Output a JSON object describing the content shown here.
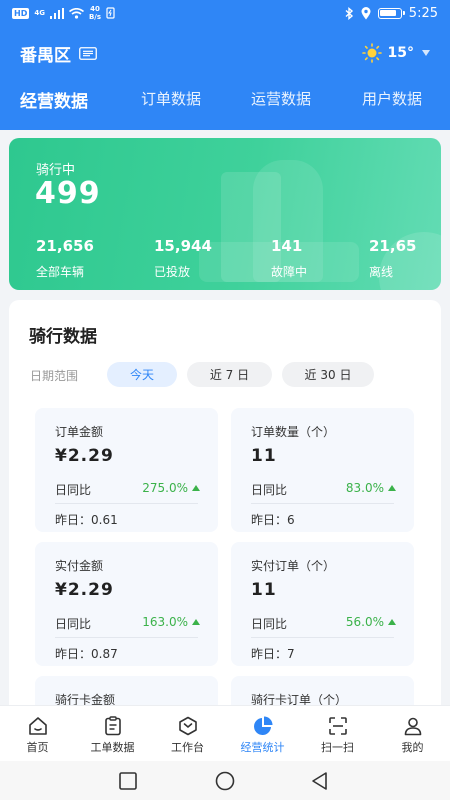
{
  "status_bar": {
    "hd_badge": "HD",
    "network": "4G",
    "speed_value": "40",
    "speed_unit": "B/s",
    "time": "5:25",
    "battery_percent": 85
  },
  "topbar": {
    "district": "番禺区",
    "temperature": "15°"
  },
  "tabs": [
    {
      "label": "经营数据",
      "active": true
    },
    {
      "label": "订单数据",
      "active": false
    },
    {
      "label": "运营数据",
      "active": false
    },
    {
      "label": "用户数据",
      "active": false
    }
  ],
  "ride_card": {
    "riding_label": "骑行中",
    "riding_value": "499",
    "stats": [
      {
        "value": "21,656",
        "label": "全部车辆"
      },
      {
        "value": "15,944",
        "label": "已投放"
      },
      {
        "value": "141",
        "label": "故障中"
      },
      {
        "value": "21,65",
        "label": "离线"
      }
    ]
  },
  "ride_data": {
    "title": "骑行数据",
    "range_label": "日期范围",
    "ranges": [
      {
        "label": "今天",
        "active": true
      },
      {
        "label": "近 7 日",
        "active": false
      },
      {
        "label": "近 30 日",
        "active": false
      }
    ],
    "metrics": [
      {
        "label": "订单金额",
        "value": "¥2.29",
        "compare_label": "日同比",
        "compare_value": "275.0%",
        "previous": "昨日：0.61"
      },
      {
        "label": "订单数量（个）",
        "value": "11",
        "compare_label": "日同比",
        "compare_value": "83.0%",
        "previous": "昨日：6"
      },
      {
        "label": "实付金额",
        "value": "¥2.29",
        "compare_label": "日同比",
        "compare_value": "163.0%",
        "previous": "昨日：0.87"
      },
      {
        "label": "实付订单（个）",
        "value": "11",
        "compare_label": "日同比",
        "compare_value": "56.0%",
        "previous": "昨日：7"
      },
      {
        "label": "骑行卡金额"
      },
      {
        "label": "骑行卡订单（个）"
      }
    ]
  },
  "bottom_nav": [
    {
      "label": "首页",
      "icon": "home-icon",
      "active": false
    },
    {
      "label": "工单数据",
      "icon": "clipboard-icon",
      "active": false
    },
    {
      "label": "工作台",
      "icon": "workbench-icon",
      "active": false
    },
    {
      "label": "经营统计",
      "icon": "pie-chart-icon",
      "active": true
    },
    {
      "label": "扫一扫",
      "icon": "scan-icon",
      "active": false
    },
    {
      "label": "我的",
      "icon": "user-icon",
      "active": false
    }
  ],
  "colors": {
    "primary": "#2f86f6",
    "ride_card_green": "#3fd19b",
    "positive": "#3bb24a",
    "metric_bg": "#f5f8fd"
  }
}
